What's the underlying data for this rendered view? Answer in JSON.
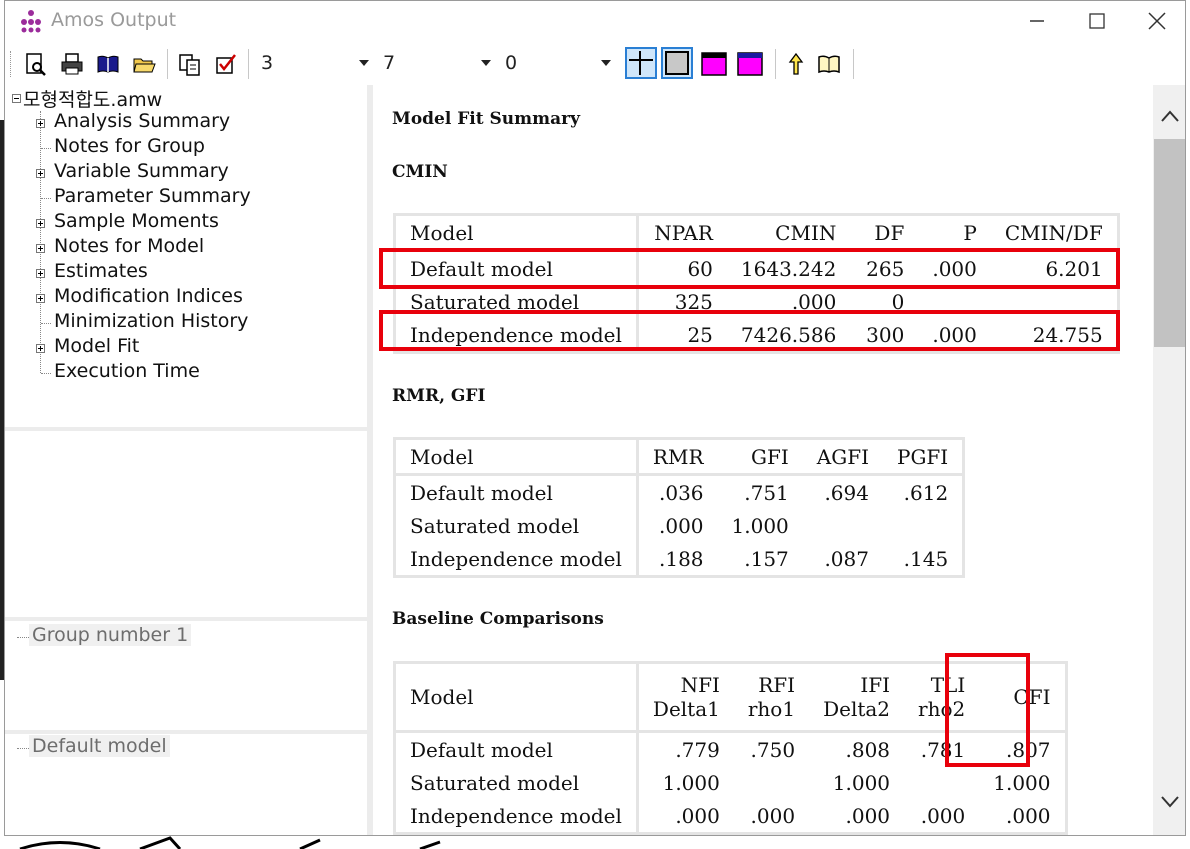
{
  "window": {
    "title": "Amos Output"
  },
  "toolbar": {
    "select1": "3",
    "select2": "7",
    "select3": "0",
    "icons": [
      "print-preview-icon",
      "print-icon",
      "open-book-icon",
      "open-folder-icon",
      "copy-icon",
      "checkbox-icon",
      "grid-lines-icon",
      "box-icon",
      "magenta-window-icon",
      "magenta-window-icon-2",
      "pointer-up-icon",
      "help-book-icon"
    ]
  },
  "tree": {
    "root": "모형적합도.amw",
    "items": [
      {
        "label": "Analysis Summary",
        "expandable": true
      },
      {
        "label": "Notes for Group",
        "expandable": false
      },
      {
        "label": "Variable Summary",
        "expandable": true
      },
      {
        "label": "Parameter Summary",
        "expandable": false
      },
      {
        "label": "Sample Moments",
        "expandable": true
      },
      {
        "label": "Notes for Model",
        "expandable": true
      },
      {
        "label": "Estimates",
        "expandable": true
      },
      {
        "label": "Modification Indices",
        "expandable": true
      },
      {
        "label": "Minimization History",
        "expandable": false
      },
      {
        "label": "Model Fit",
        "expandable": true
      },
      {
        "label": "Execution Time",
        "expandable": false
      }
    ]
  },
  "groups": {
    "group_label": "Group number 1",
    "model_label": "Default model"
  },
  "content": {
    "title": "Model Fit Summary",
    "cmin": {
      "heading": "CMIN",
      "headers": [
        "Model",
        "NPAR",
        "CMIN",
        "DF",
        "P",
        "CMIN/DF"
      ],
      "rows": [
        [
          "Default model",
          "60",
          "1643.242",
          "265",
          ".000",
          "6.201"
        ],
        [
          "Saturated model",
          "325",
          ".000",
          "0",
          "",
          ""
        ],
        [
          "Independence model",
          "25",
          "7426.586",
          "300",
          ".000",
          "24.755"
        ]
      ]
    },
    "rmr": {
      "heading": "RMR, GFI",
      "headers": [
        "Model",
        "RMR",
        "GFI",
        "AGFI",
        "PGFI"
      ],
      "rows": [
        [
          "Default model",
          ".036",
          ".751",
          ".694",
          ".612"
        ],
        [
          "Saturated model",
          ".000",
          "1.000",
          "",
          ""
        ],
        [
          "Independence model",
          ".188",
          ".157",
          ".087",
          ".145"
        ]
      ]
    },
    "baseline": {
      "heading": "Baseline Comparisons",
      "headers": [
        {
          "top": "",
          "bottom": "Model"
        },
        {
          "top": "NFI",
          "bottom": "Delta1"
        },
        {
          "top": "RFI",
          "bottom": "rho1"
        },
        {
          "top": "IFI",
          "bottom": "Delta2"
        },
        {
          "top": "TLI",
          "bottom": "rho2"
        },
        {
          "top": "",
          "bottom": "CFI"
        }
      ],
      "rows": [
        [
          "Default model",
          ".779",
          ".750",
          ".808",
          ".781",
          ".807"
        ],
        [
          "Saturated model",
          "1.000",
          "",
          "1.000",
          "",
          "1.000"
        ],
        [
          "Independence model",
          ".000",
          ".000",
          ".000",
          ".000",
          ".000"
        ]
      ]
    }
  },
  "highlight_color": "#e8000b"
}
